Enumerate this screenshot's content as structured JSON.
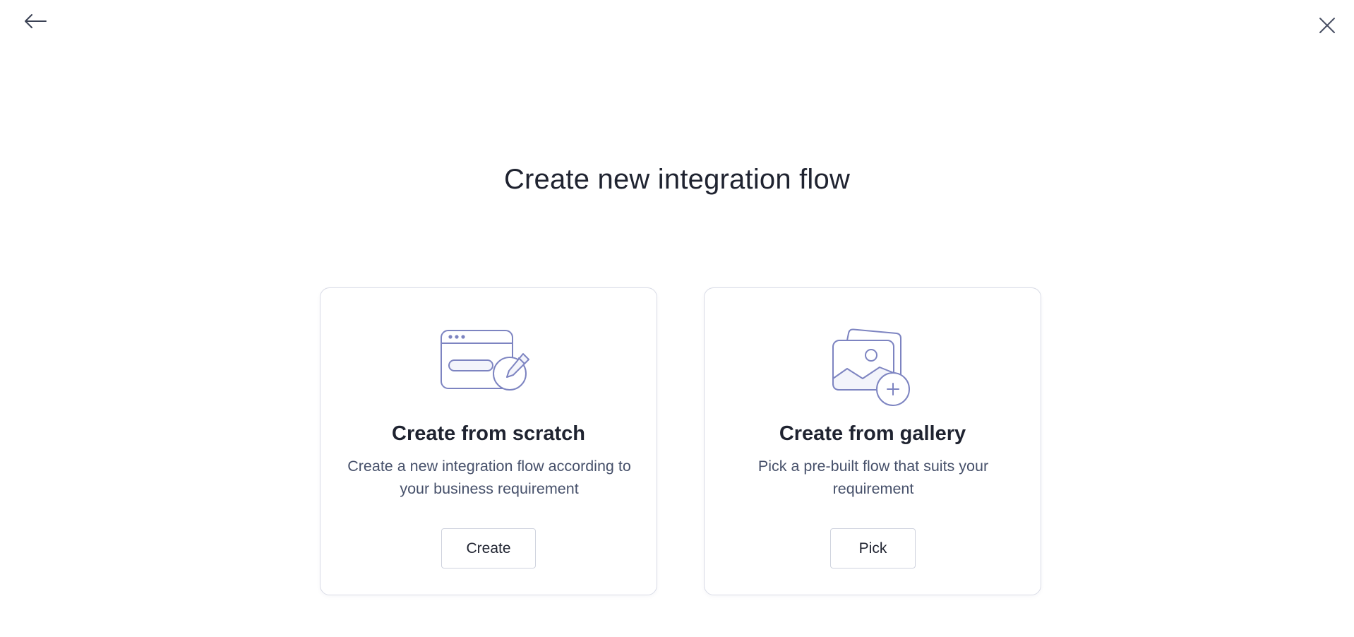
{
  "header": {
    "back_icon": "arrow-left-icon",
    "close_icon": "close-icon"
  },
  "page": {
    "title": "Create new integration flow"
  },
  "cards": [
    {
      "icon": "browser-edit-icon",
      "title": "Create from scratch",
      "description": "Create a new integration flow according to your business requirement",
      "button_label": "Create"
    },
    {
      "icon": "gallery-add-icon",
      "title": "Create from gallery",
      "description": "Pick a pre-built flow that suits your requirement",
      "button_label": "Pick"
    }
  ],
  "colors": {
    "illustration_stroke": "#7d84c1",
    "illustration_fill": "#f3f4fb",
    "card_border": "#d8dbe6",
    "text_primary": "#1f2330",
    "text_secondary": "#46506a"
  }
}
